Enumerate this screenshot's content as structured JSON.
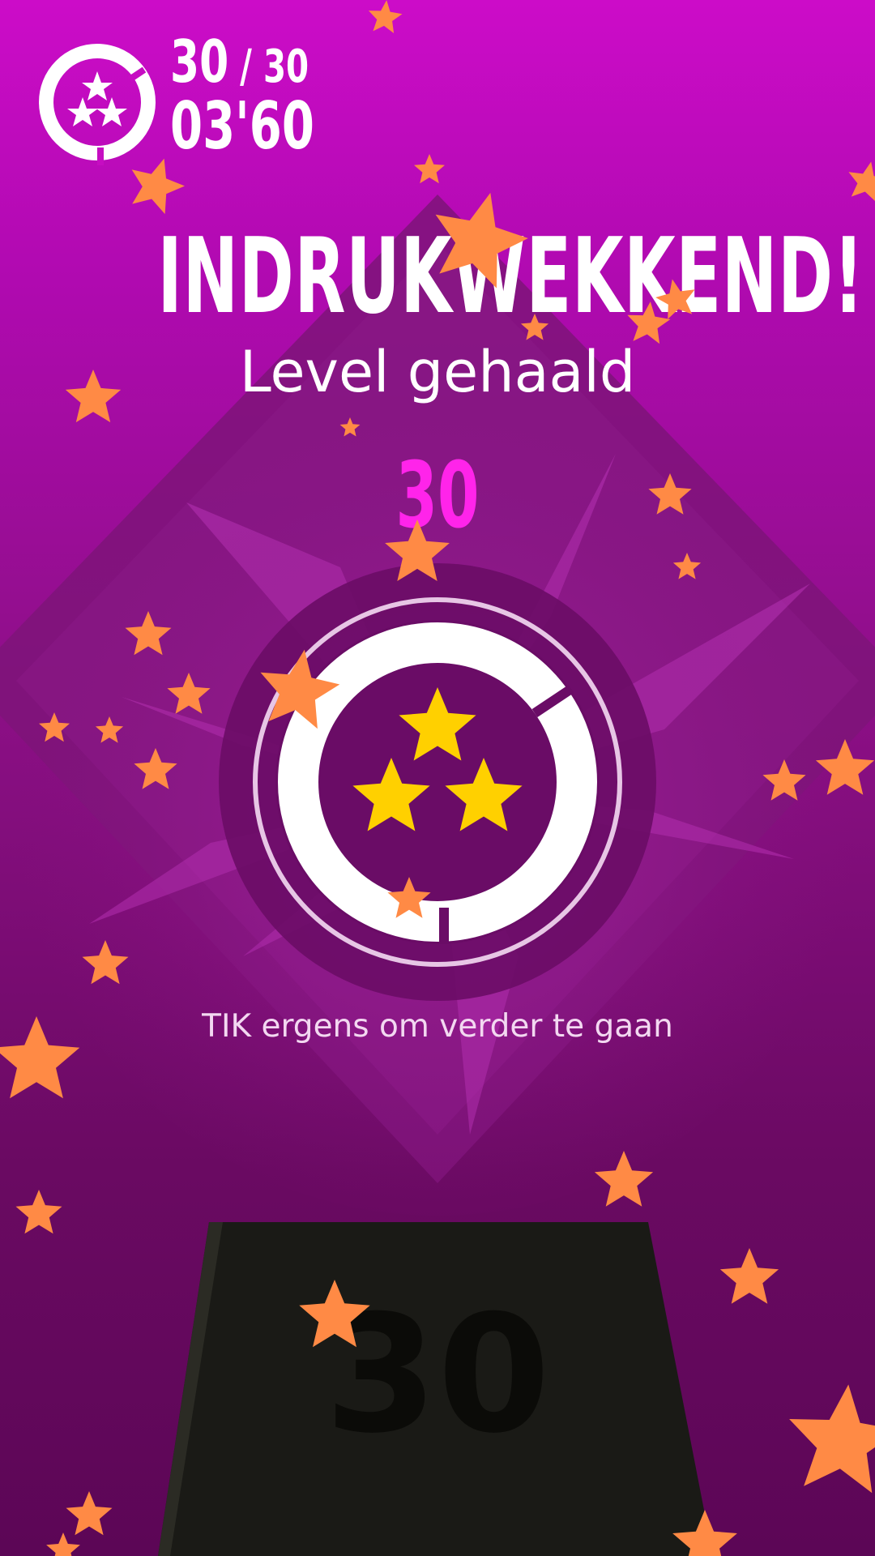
{
  "hud": {
    "stars_collected": "30",
    "separator": "/",
    "stars_total": "30",
    "time": "03'60"
  },
  "result": {
    "headline": "INDRUKWEKKEND!",
    "subtitle": "Level gehaald",
    "level_number": "30",
    "star_rating": 3,
    "max_stars": 3
  },
  "instruction": "TIK ergens om verder te gaan",
  "next_block_label": "30",
  "colors": {
    "background_top": "#cc0cc8",
    "background_bottom": "#5c0656",
    "level_number": "#ff24ea",
    "rating_star": "#ffd000",
    "confetti_star": "#ff8a45",
    "block": "#1a1a16"
  }
}
